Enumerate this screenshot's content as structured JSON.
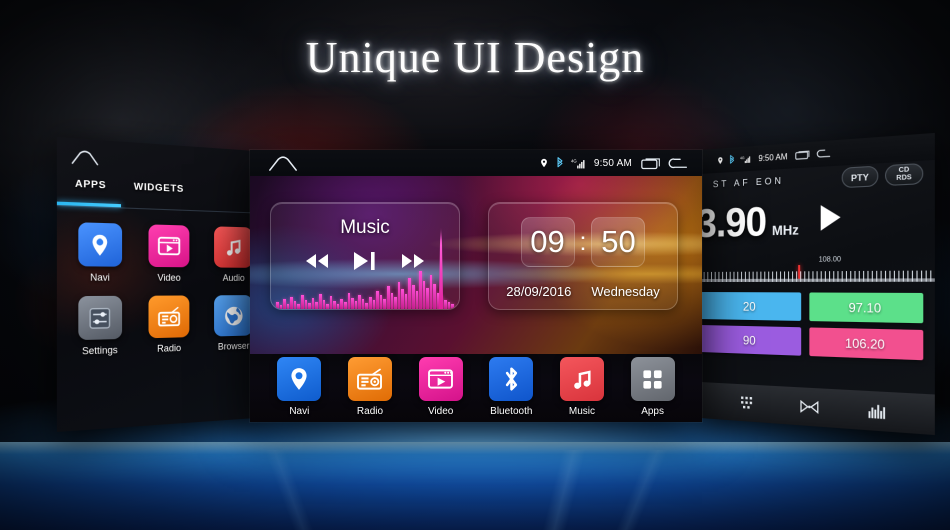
{
  "headline": "Unique UI Design",
  "left_panel": {
    "home_icon": "home-icon",
    "tabs": [
      {
        "label": "APPS",
        "active": true
      },
      {
        "label": "WIDGETS",
        "active": false
      }
    ],
    "apps": [
      {
        "label": "Navi",
        "icon": "location-pin-icon",
        "color": "#2f7ef2"
      },
      {
        "label": "Video",
        "icon": "video-player-icon",
        "color": "#f2209c"
      },
      {
        "label": "Audio",
        "icon": "music-note-icon",
        "color": "#ef4545"
      },
      {
        "label": "Settings",
        "icon": "sliders-icon",
        "color": "#6b7380"
      },
      {
        "label": "Radio",
        "icon": "radio-icon",
        "color": "#f07b16"
      },
      {
        "label": "Browser",
        "icon": "globe-icon",
        "color": "#3b8ee8"
      }
    ]
  },
  "center_panel": {
    "home_icon": "home-icon",
    "status": {
      "location_icon": "location-pin-icon",
      "bluetooth_icon": "bluetooth-icon",
      "network_icon": "signal-4g-icon",
      "time": "9:50 AM",
      "recents_icon": "recents-icon",
      "back_icon": "back-arrow-icon"
    },
    "music_widget": {
      "title": "Music",
      "prev_icon": "rewind-icon",
      "play_pause_icon": "play-pause-icon",
      "next_icon": "fast-forward-icon",
      "spectrum": [
        12,
        8,
        18,
        10,
        22,
        14,
        9,
        26,
        16,
        11,
        20,
        13,
        28,
        17,
        10,
        24,
        15,
        9,
        19,
        12,
        30,
        21,
        14,
        26,
        18,
        11,
        23,
        16,
        34,
        25,
        19,
        42,
        30,
        22,
        50,
        36,
        27,
        58,
        44,
        33,
        70,
        52,
        38,
        62,
        46,
        30,
        24,
        16,
        12,
        9
      ]
    },
    "clock_widget": {
      "hours": "09",
      "separator": ":",
      "minutes": "50",
      "date": "28/09/2016",
      "weekday": "Wednesday"
    },
    "dock": [
      {
        "label": "Navi",
        "icon": "location-pin-icon",
        "color": "#1a73e8"
      },
      {
        "label": "Radio",
        "icon": "radio-icon",
        "color": "#f0801a"
      },
      {
        "label": "Video",
        "icon": "video-player-icon",
        "color": "#f0219c"
      },
      {
        "label": "Bluetooth",
        "icon": "bluetooth-icon",
        "color": "#1668e0"
      },
      {
        "label": "Music",
        "icon": "music-note-icon",
        "color": "#e8434a"
      },
      {
        "label": "Apps",
        "icon": "app-grid-icon",
        "color": "#7b7f86"
      }
    ]
  },
  "right_panel": {
    "status": {
      "location_icon": "location-pin-icon",
      "bluetooth_icon": "bluetooth-icon",
      "network_icon": "signal-4g-icon",
      "time": "9:50 AM",
      "recents_icon": "recents-icon",
      "back_icon": "back-arrow-icon"
    },
    "rds_flags": "ST  AF  EON",
    "buttons": [
      {
        "label": "PTY",
        "name": "pty-button"
      },
      {
        "label": "CD",
        "sub": "RDS",
        "name": "cd-rds-button"
      }
    ],
    "frequency": "3.90",
    "unit": "MHz",
    "play_icon": "play-icon",
    "scale_max_label": "108.00",
    "presets": [
      {
        "value": "20",
        "color": "#4ab6ef"
      },
      {
        "value": "97.10",
        "color": "#5ce08a"
      },
      {
        "value": "90",
        "color": "#9b5ce0"
      },
      {
        "value": "106.20",
        "color": "#f2508f"
      }
    ],
    "bottom_icons": [
      {
        "name": "keypad-icon"
      },
      {
        "name": "balance-fader-icon"
      },
      {
        "name": "equalizer-icon"
      }
    ]
  }
}
